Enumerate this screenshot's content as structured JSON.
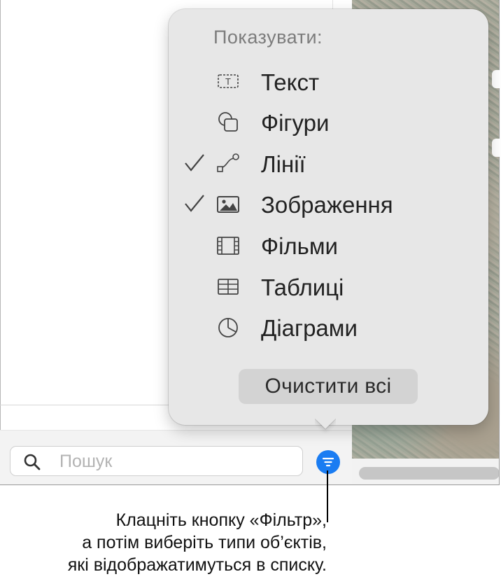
{
  "search": {
    "placeholder": "Пошук"
  },
  "filter_popover": {
    "title": "Показувати:",
    "items": [
      {
        "label": "Текст",
        "checked": false,
        "icon": "text-box-icon"
      },
      {
        "label": "Фігури",
        "checked": false,
        "icon": "shapes-icon"
      },
      {
        "label": "Лінії",
        "checked": true,
        "icon": "line-icon"
      },
      {
        "label": "Зображення",
        "checked": true,
        "icon": "image-icon"
      },
      {
        "label": "Фільми",
        "checked": false,
        "icon": "film-icon"
      },
      {
        "label": "Таблиці",
        "checked": false,
        "icon": "table-icon"
      },
      {
        "label": "Діаграми",
        "checked": false,
        "icon": "pie-chart-icon"
      }
    ],
    "clear_label": "Очистити всі"
  },
  "caption": {
    "lines": [
      "Клацніть кнопку «Фільтр»,",
      "а потім виберіть типи об’єктів,",
      "які відображатимуться в списку."
    ]
  },
  "colors": {
    "accent": "#1a7cf2",
    "popover_bg": "#e7e7e7",
    "clear_button_bg": "#d3d3d3"
  }
}
